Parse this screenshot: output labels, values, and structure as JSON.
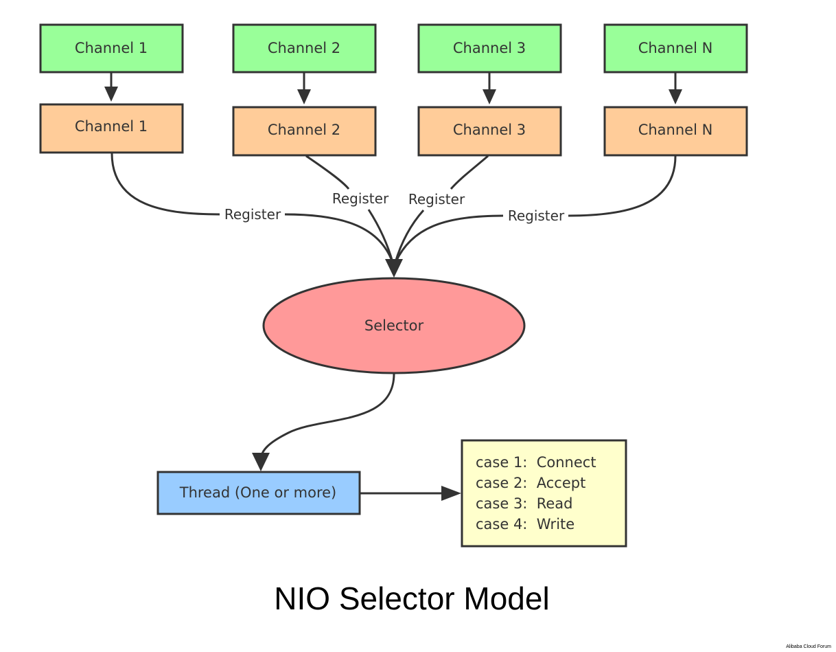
{
  "title": "NIO Selector Model",
  "watermark": "Alibaba Cloud Forum",
  "colors": {
    "channel_top": "#99ff99",
    "channel_bottom": "#ffcc99",
    "selector": "#ff9999",
    "thread": "#99ccff",
    "cases": "#ffffcc",
    "stroke": "#333333"
  },
  "channels_top": [
    {
      "label": "Channel 1"
    },
    {
      "label": "Channel 2"
    },
    {
      "label": "Channel 3"
    },
    {
      "label": "Channel N"
    }
  ],
  "channels_bottom": [
    {
      "label": "Channel 1"
    },
    {
      "label": "Channel 2"
    },
    {
      "label": "Channel 3"
    },
    {
      "label": "Channel N"
    }
  ],
  "edge_labels": [
    "Register",
    "Register",
    "Register",
    "Register"
  ],
  "selector": {
    "label": "Selector"
  },
  "thread": {
    "label": "Thread (One or more)"
  },
  "cases": [
    "case 1:  Connect",
    "case 2:  Accept",
    "case 3:  Read",
    "case 4:  Write"
  ]
}
